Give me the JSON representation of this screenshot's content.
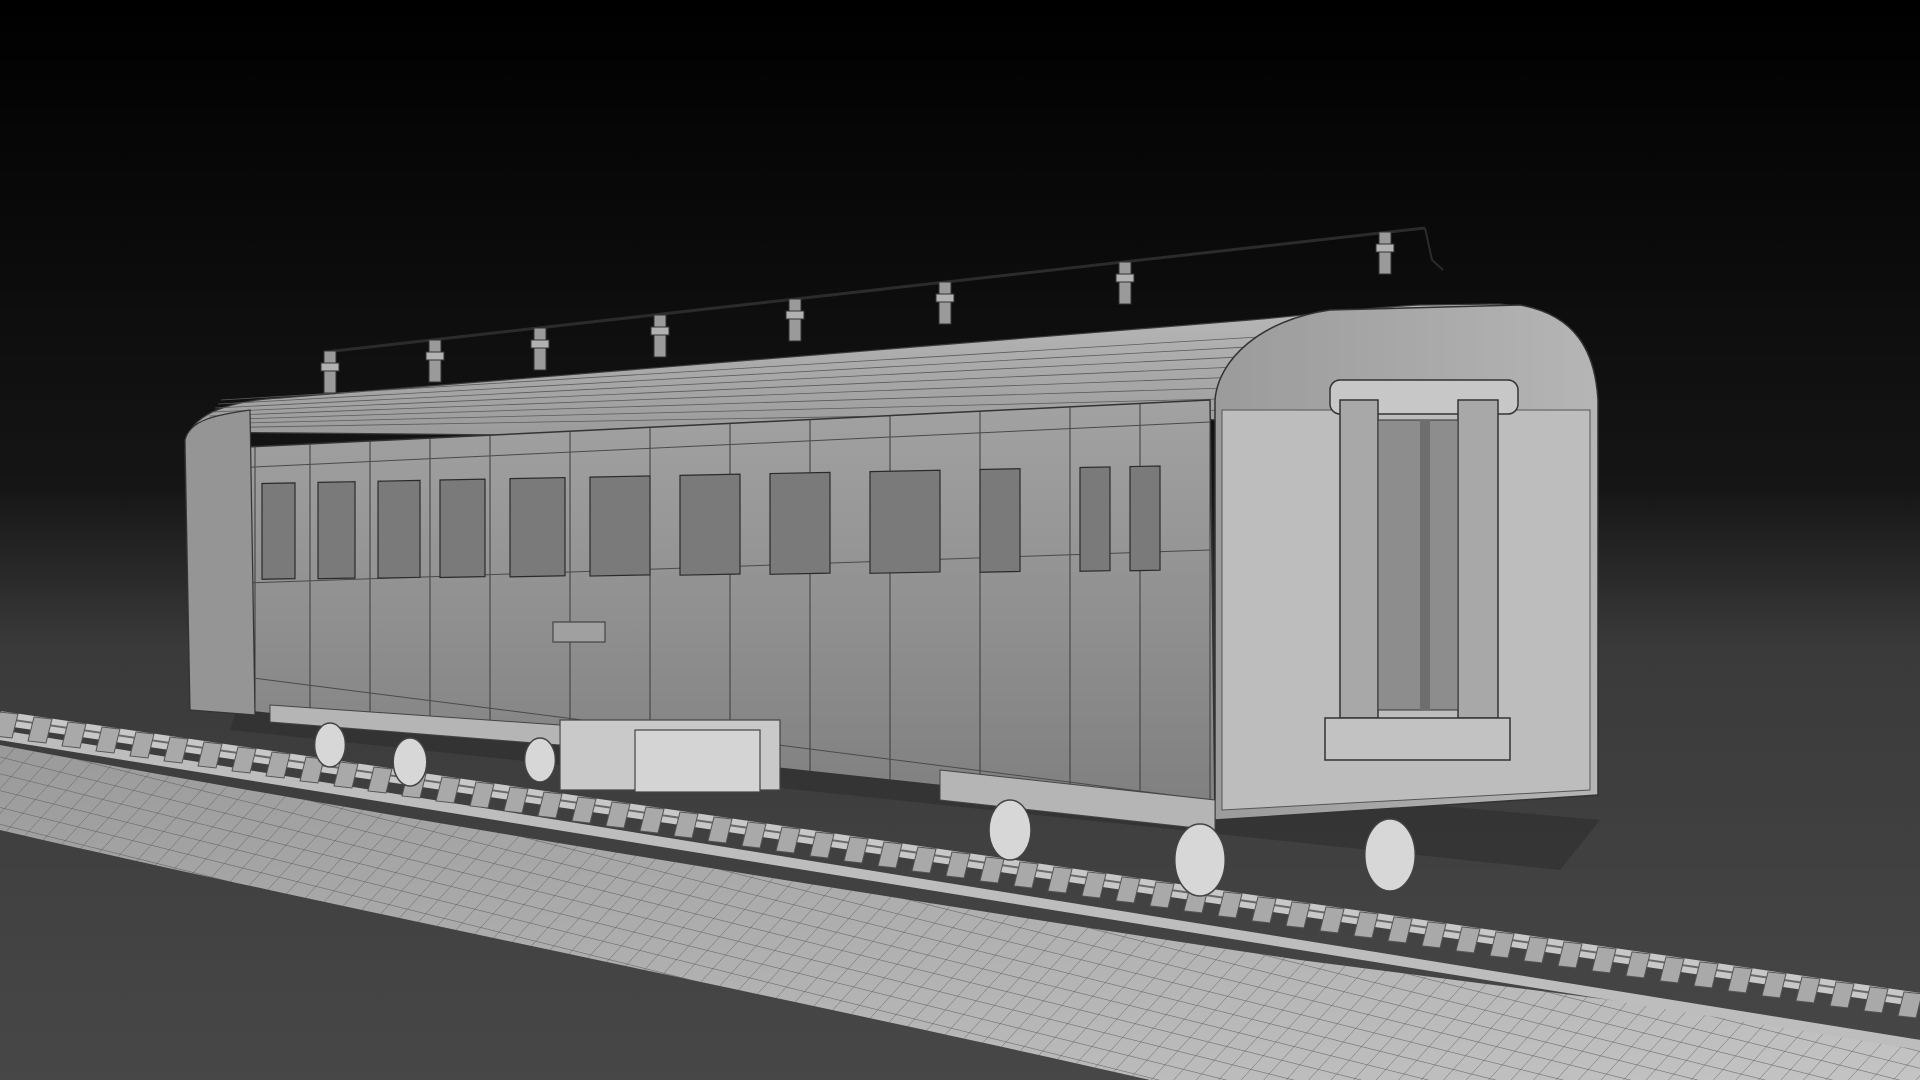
{
  "scene": {
    "subject": "railway-passenger-car-wireframe-render",
    "colors": {
      "background_top": "#000000",
      "background_mid": "#2b2b2b",
      "floor": "#4a4a4a",
      "ballast": "#b4b4b4",
      "car_body": "#8f8f8f",
      "car_body_light": "#a9a9a9",
      "roof": "#9c9c9c",
      "wire": "#2a2a2a",
      "metal": "#c9c9c9"
    }
  }
}
